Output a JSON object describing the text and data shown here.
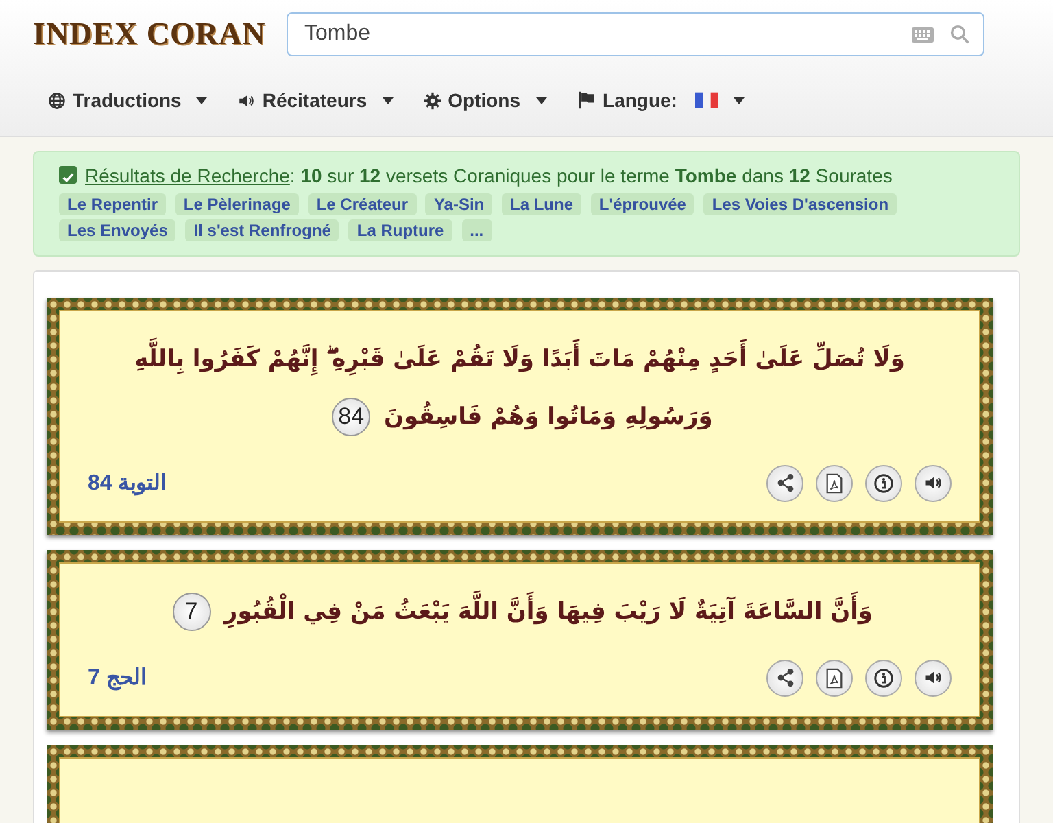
{
  "header": {
    "logo": "INDEX CORAN",
    "search": {
      "value": "Tombe"
    }
  },
  "menu": [
    {
      "label": "Traductions"
    },
    {
      "label": "Récitateurs"
    },
    {
      "label": "Options"
    },
    {
      "label": "Langue:"
    }
  ],
  "results": {
    "checked": true,
    "link": "Résultats de Recherche",
    "summary": ": **10** sur **12** versets Coraniques pour le terme **Tombe** dans **12** Sourates",
    "tags": [
      "Le Repentir",
      "Le Pèlerinage",
      "Le Créateur",
      "Ya-Sin",
      "La Lune",
      "L'éprouvée",
      "Les Voies D'ascension",
      "Les Envoyés",
      "Il s'est Renfrogné",
      "La Rupture",
      "..."
    ]
  },
  "verses": [
    {
      "text": "وَلَا تُصَلِّ عَلَىٰ أَحَدٍ مِنْهُمْ مَاتَ أَبَدًا وَلَا تَقُمْ عَلَىٰ قَبْرِهِ ۖ إِنَّهُمْ كَفَرُوا بِاللَّهِ وَرَسُولِهِ وَمَاتُوا وَهُمْ فَاسِقُونَ",
      "number": "84",
      "reference": "التوبة 84"
    },
    {
      "text": "وَأَنَّ السَّاعَةَ آتِيَةٌ لَا رَيْبَ فِيهَا وَأَنَّ اللَّهَ يَبْعَثُ مَنْ فِي الْقُبُورِ",
      "number": "7",
      "reference": "الحج 7"
    }
  ]
}
